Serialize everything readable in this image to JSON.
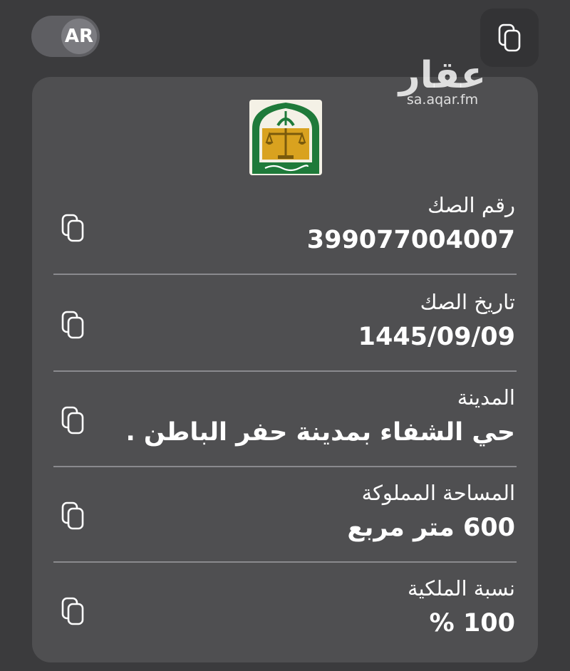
{
  "header": {
    "language_toggle": "AR"
  },
  "watermark": {
    "brand": "عقار",
    "domain": "sa.aqar.fm"
  },
  "deed": {
    "rows": [
      {
        "label": "رقم الصك",
        "value": "399077004007"
      },
      {
        "label": "تاريخ الصك",
        "value": "1445/09/09"
      },
      {
        "label": "المدينة",
        "value": "حي  الشفاء  بمدينة حفر الباطن ."
      },
      {
        "label": "المساحة المملوكة",
        "value": "600 متر مربع"
      },
      {
        "label": "نسبة الملكية",
        "value": "100 %"
      }
    ]
  },
  "icons": {
    "copy": "copy-icon",
    "emblem": "ministry-of-justice-emblem"
  },
  "colors": {
    "background": "#3b3b3d",
    "card": "#4f4f51",
    "emblem_green": "#1f7a3a",
    "emblem_gold": "#d9a21f"
  }
}
